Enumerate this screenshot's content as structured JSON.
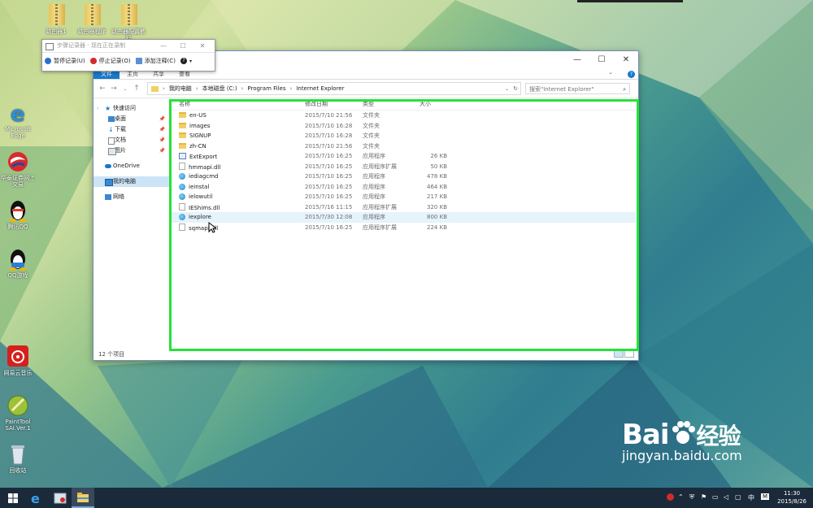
{
  "desktop": {
    "top_folders": [
      {
        "label": "路由器1"
      },
      {
        "label": "路由器程序"
      },
      {
        "label": "路由器配置教程"
      }
    ],
    "icons": [
      {
        "label": "Microsoft Edge"
      },
      {
        "label": "华泰证券网上交易"
      },
      {
        "label": "腾讯QQ"
      },
      {
        "label": "QQ游戏"
      },
      {
        "label": "网易云音乐"
      },
      {
        "label": "PaintTool SAI.Ver.1"
      },
      {
        "label": "回收站"
      }
    ]
  },
  "steps_recorder": {
    "title": "步骤记录器 - 现在正在录制",
    "pause_label": "暂停记录(U)",
    "stop_label": "停止记录(O)",
    "comment_label": "添加注释(C)",
    "minimize": "—",
    "maximize": "☐",
    "close": "✕"
  },
  "explorer": {
    "minimize": "—",
    "maximize": "☐",
    "close": "✕",
    "ribbon_tabs": [
      "文件",
      "主页",
      "共享",
      "查看"
    ],
    "address_path": [
      "我的电脑",
      "本地磁盘 (C:)",
      "Program Files",
      "Internet Explorer"
    ],
    "search_placeholder": "搜索\"Internet Explorer\"",
    "nav": {
      "quick_access": "快速访问",
      "pinned": [
        "桌面",
        "下载",
        "文档",
        "图片"
      ],
      "onedrive": "OneDrive",
      "this_pc": "我的电脑",
      "network": "网络"
    },
    "columns": [
      "名称",
      "修改日期",
      "类型",
      "大小"
    ],
    "files": [
      {
        "name": "en-US",
        "date": "2015/7/10 21:56",
        "type": "文件夹",
        "size": "",
        "icon": "folder"
      },
      {
        "name": "images",
        "date": "2015/7/10 16:28",
        "type": "文件夹",
        "size": "",
        "icon": "folder"
      },
      {
        "name": "SIGNUP",
        "date": "2015/7/10 16:28",
        "type": "文件夹",
        "size": "",
        "icon": "folder"
      },
      {
        "name": "zh-CN",
        "date": "2015/7/10 21:56",
        "type": "文件夹",
        "size": "",
        "icon": "folder"
      },
      {
        "name": "ExtExport",
        "date": "2015/7/10 16:25",
        "type": "应用程序",
        "size": "26 KB",
        "icon": "exe"
      },
      {
        "name": "hmmapi.dll",
        "date": "2015/7/10 16:25",
        "type": "应用程序扩展",
        "size": "50 KB",
        "icon": "dll"
      },
      {
        "name": "iediagcmd",
        "date": "2015/7/10 16:25",
        "type": "应用程序",
        "size": "478 KB",
        "icon": "ie"
      },
      {
        "name": "ieinstal",
        "date": "2015/7/10 16:25",
        "type": "应用程序",
        "size": "464 KB",
        "icon": "ie"
      },
      {
        "name": "ielowutil",
        "date": "2015/7/10 16:25",
        "type": "应用程序",
        "size": "217 KB",
        "icon": "ie"
      },
      {
        "name": "IEShims.dll",
        "date": "2015/7/16 11:15",
        "type": "应用程序扩展",
        "size": "320 KB",
        "icon": "dll"
      },
      {
        "name": "iexplore",
        "date": "2015/7/30 12:08",
        "type": "应用程序",
        "size": "800 KB",
        "icon": "ie"
      },
      {
        "name": "sqmapi.dll",
        "date": "2015/7/10 16:25",
        "type": "应用程序扩展",
        "size": "224 KB",
        "icon": "dll"
      }
    ],
    "status": "12 个项目"
  },
  "taskbar": {
    "tray_lang": "中",
    "tray_m": "M",
    "time": "11:30",
    "date": "2015/8/26"
  },
  "watermark": {
    "brand": "Bai",
    "brand_cn": "经验",
    "url": "jingyan.baidu.com"
  },
  "colors": {
    "highlight_box": "#26e13a",
    "ribbon_active": "#1979ca",
    "taskbar": "#1a2a3a"
  }
}
